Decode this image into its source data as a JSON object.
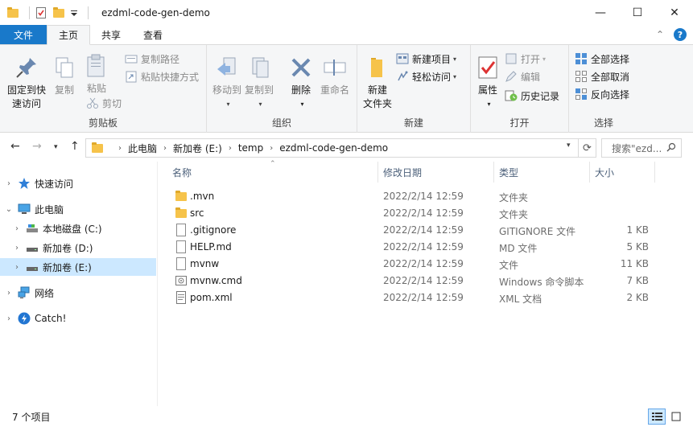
{
  "window": {
    "title": "ezdml-code-gen-demo",
    "minimize_glyph": "—",
    "maximize_glyph": "☐",
    "close_glyph": "✕"
  },
  "ribbon_tabs": {
    "file": "文件",
    "home": "主页",
    "share": "共享",
    "view": "查看",
    "expand_glyph": "⌃",
    "help_glyph": "?"
  },
  "ribbon": {
    "clipboard": {
      "label": "剪贴板",
      "pin": "固定到快\n速访问",
      "copy": "复制",
      "paste": "粘贴",
      "copy_path": "复制路径",
      "paste_shortcut": "粘贴快捷方式",
      "cut": "剪切"
    },
    "organize": {
      "label": "组织",
      "move_to": "移动到",
      "copy_to": "复制到",
      "delete": "删除",
      "rename": "重命名"
    },
    "new": {
      "label": "新建",
      "new_folder": "新建\n文件夹",
      "new_item": "新建项目",
      "easy_access": "轻松访问"
    },
    "open": {
      "label": "打开",
      "properties": "属性",
      "open": "打开",
      "edit": "编辑",
      "history": "历史记录"
    },
    "select": {
      "label": "选择",
      "select_all": "全部选择",
      "select_none": "全部取消",
      "invert": "反向选择"
    }
  },
  "address": {
    "crumbs": [
      "此电脑",
      "新加卷 (E:)",
      "temp",
      "ezdml-code-gen-demo"
    ],
    "search_placeholder": "搜索\"ezd..."
  },
  "nav": {
    "items": [
      {
        "label": "快速访问",
        "icon": "star-icon"
      },
      {
        "label": "此电脑",
        "icon": "computer-icon"
      },
      {
        "label": "本地磁盘 (C:)",
        "icon": "drive-icon"
      },
      {
        "label": "新加卷 (D:)",
        "icon": "drive-icon"
      },
      {
        "label": "新加卷 (E:)",
        "icon": "drive-icon"
      },
      {
        "label": "网络",
        "icon": "network-icon"
      },
      {
        "label": "Catch!",
        "icon": "catch-icon"
      }
    ]
  },
  "columns": {
    "name": "名称",
    "date": "修改日期",
    "type": "类型",
    "size": "大小"
  },
  "files": [
    {
      "name": ".mvn",
      "date": "2022/2/14 12:59",
      "type": "文件夹",
      "size": "",
      "icon": "folder-icon"
    },
    {
      "name": "src",
      "date": "2022/2/14 12:59",
      "type": "文件夹",
      "size": "",
      "icon": "folder-icon"
    },
    {
      "name": ".gitignore",
      "date": "2022/2/14 12:59",
      "type": "GITIGNORE 文件",
      "size": "1 KB",
      "icon": "file-icon"
    },
    {
      "name": "HELP.md",
      "date": "2022/2/14 12:59",
      "type": "MD 文件",
      "size": "5 KB",
      "icon": "file-icon"
    },
    {
      "name": "mvnw",
      "date": "2022/2/14 12:59",
      "type": "文件",
      "size": "11 KB",
      "icon": "file-icon"
    },
    {
      "name": "mvnw.cmd",
      "date": "2022/2/14 12:59",
      "type": "Windows 命令脚本",
      "size": "7 KB",
      "icon": "cmd-file-icon"
    },
    {
      "name": "pom.xml",
      "date": "2022/2/14 12:59",
      "type": "XML 文档",
      "size": "2 KB",
      "icon": "xml-file-icon"
    }
  ],
  "status": {
    "count": "7 个项目"
  },
  "colors": {
    "accent": "#1979ca",
    "selection": "#cce8ff",
    "folder": "#f6c34a"
  }
}
